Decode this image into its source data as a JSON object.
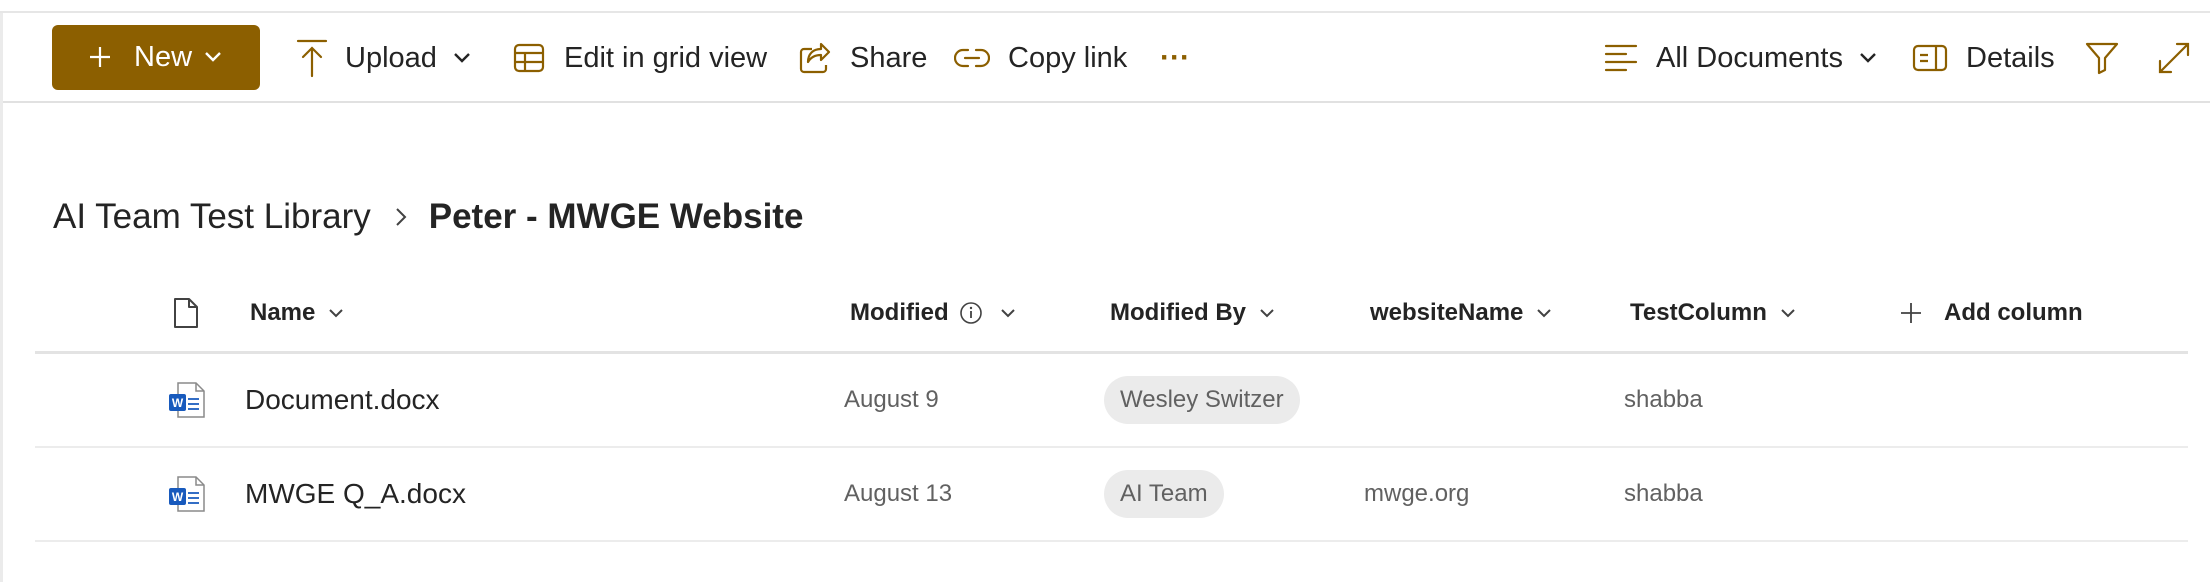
{
  "toolbar": {
    "new_label": "New",
    "upload_label": "Upload",
    "grid_label": "Edit in grid view",
    "share_label": "Share",
    "copy_link_label": "Copy link",
    "more_label": "···",
    "view_label": "All Documents",
    "details_label": "Details"
  },
  "breadcrumb": {
    "parent": "AI Team Test Library",
    "current": "Peter - MWGE Website"
  },
  "columns": {
    "name": "Name",
    "modified": "Modified",
    "modified_by": "Modified By",
    "website_name": "websiteName",
    "test_column": "TestColumn",
    "add_column": "Add column"
  },
  "rows": [
    {
      "name": "Document.docx",
      "modified": "August 9",
      "modified_by": "Wesley Switzer",
      "website_name": "",
      "test_column": "shabba"
    },
    {
      "name": "MWGE Q_A.docx",
      "modified": "August 13",
      "modified_by": "AI Team",
      "website_name": "mwge.org",
      "test_column": "shabba"
    }
  ],
  "icons": {
    "word": "word-document-icon",
    "file": "file-type-icon"
  },
  "colors": {
    "accent": "#8c5f00",
    "word_blue": "#185abd"
  }
}
